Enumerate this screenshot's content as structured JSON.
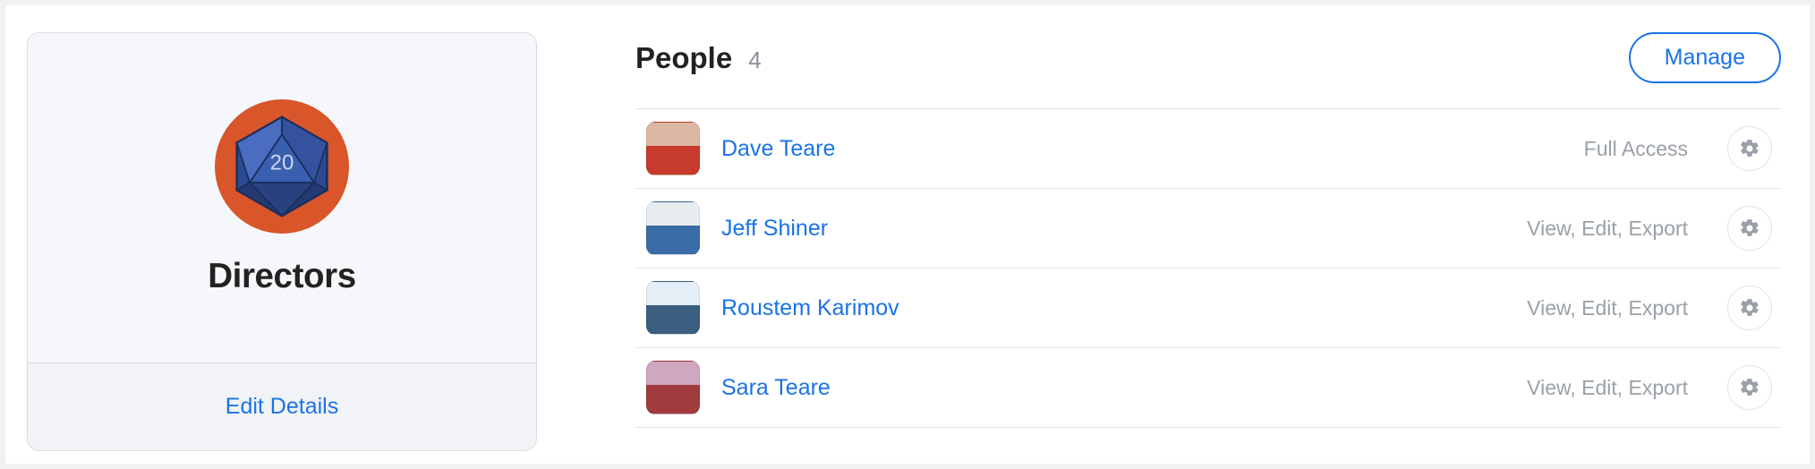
{
  "group": {
    "name": "Directors",
    "icon_label": "20",
    "edit_label": "Edit Details"
  },
  "people": {
    "title": "People",
    "count": "4",
    "manage_label": "Manage",
    "members": [
      {
        "name": "Dave Teare",
        "access": "Full Access",
        "avatar_colors": [
          "#dcb8a4",
          "#c63b2c"
        ]
      },
      {
        "name": "Jeff Shiner",
        "access": "View, Edit, Export",
        "avatar_colors": [
          "#e8ecef",
          "#3a6ca8"
        ]
      },
      {
        "name": "Roustem Karimov",
        "access": "View, Edit, Export",
        "avatar_colors": [
          "#e4eef6",
          "#3a5e7d"
        ]
      },
      {
        "name": "Sara Teare",
        "access": "View, Edit, Export",
        "avatar_colors": [
          "#cfa7c0",
          "#a13b3d"
        ]
      }
    ]
  }
}
